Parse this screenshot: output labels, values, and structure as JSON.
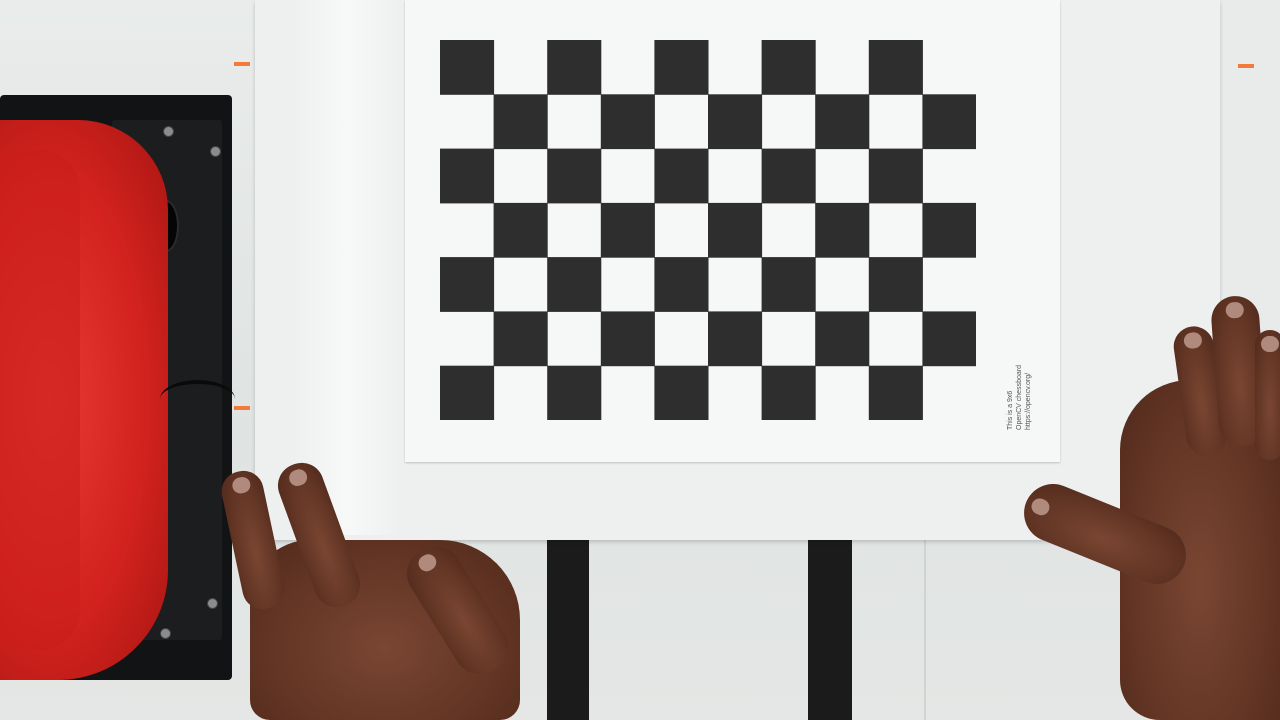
{
  "scene": {
    "subject": "camera calibration chessboard held on a board by two hands",
    "colors": {
      "table": "#e3e6e4",
      "board": "#eef0ef",
      "paper": "#f6f7f7",
      "square_dark": "#2e2e2e",
      "tape": "#1b1b1c",
      "camera_box": "#121314",
      "cap": "#d4231f",
      "skin": "#5e3222"
    }
  },
  "chessboard": {
    "columns": 10,
    "rows": 7
  },
  "caption": {
    "line1": "This is a 9x6",
    "line2": "OpenCV chessboard",
    "line3": "https://opencv.org/"
  }
}
